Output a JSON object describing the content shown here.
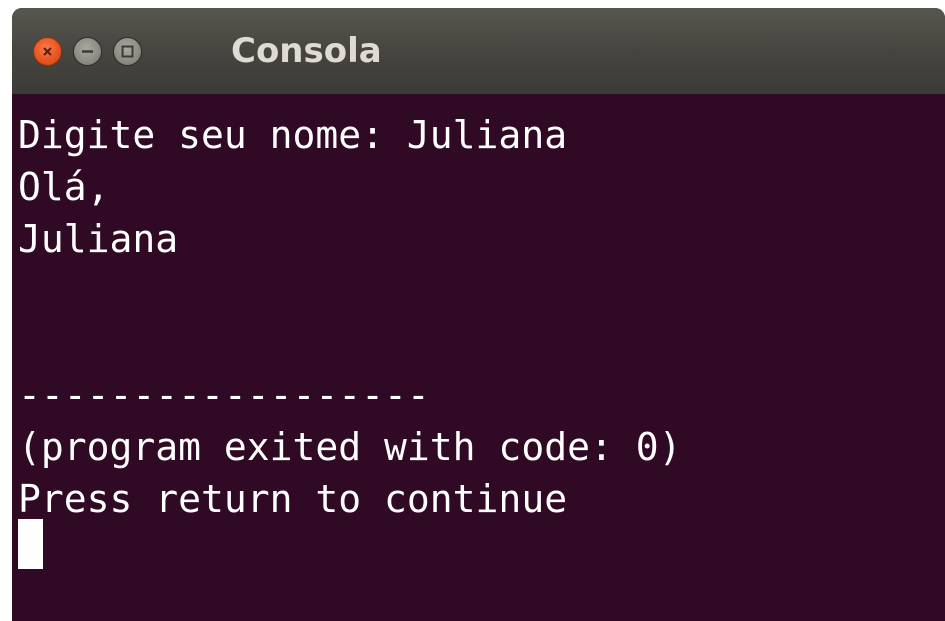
{
  "window": {
    "title": "Consola"
  },
  "terminal": {
    "lines": [
      "Digite seu nome: Juliana",
      "Olá,",
      "Juliana",
      "",
      "",
      "------------------",
      "(program exited with code: 0)",
      "Press return to continue"
    ],
    "background_color": "#300a24",
    "text_color": "#ffffff"
  },
  "controls": {
    "close_icon": "close-x-icon",
    "minimize_icon": "minimize-icon",
    "maximize_icon": "maximize-icon",
    "close_color": "#e8561f",
    "button_color": "#8c8a82"
  }
}
